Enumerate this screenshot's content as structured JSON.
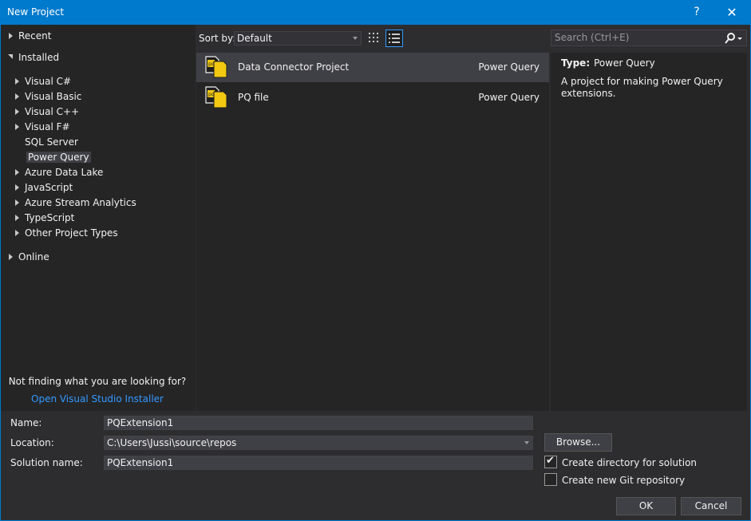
{
  "window": {
    "title": "New Project",
    "help": "?",
    "close": "✕"
  },
  "tree": {
    "recent": "Recent",
    "installed": "Installed",
    "children": [
      "Visual C#",
      "Visual Basic",
      "Visual C++",
      "Visual F#",
      "SQL Server",
      "Power Query",
      "Azure Data Lake",
      "JavaScript",
      "Azure Stream Analytics",
      "TypeScript",
      "Other Project Types"
    ],
    "online": "Online",
    "not_finding": "Not finding what you are looking for?",
    "installer_link": "Open Visual Studio Installer"
  },
  "sort": {
    "label": "Sort by:",
    "value": "Default"
  },
  "search": {
    "placeholder": "Search (Ctrl+E)"
  },
  "projects": [
    {
      "name": "Data Connector Project",
      "language": "Power Query"
    },
    {
      "name": "PQ file",
      "language": "Power Query"
    }
  ],
  "info": {
    "type_label": "Type:",
    "type_value": "Power Query",
    "description": "A project for making Power Query extensions."
  },
  "form": {
    "name_label": "Name:",
    "name_value": "PQExtension1",
    "location_label": "Location:",
    "location_value": "C:\\Users\\Jussi\\source\\repos",
    "solution_label": "Solution name:",
    "solution_value": "PQExtension1",
    "browse": "Browse...",
    "create_dir": "Create directory for solution",
    "create_git": "Create new Git repository",
    "ok": "OK",
    "cancel": "Cancel"
  },
  "colors": {
    "accent": "#007acc",
    "background": "#2d2d30",
    "panel": "#252526",
    "link": "#3399ff"
  }
}
